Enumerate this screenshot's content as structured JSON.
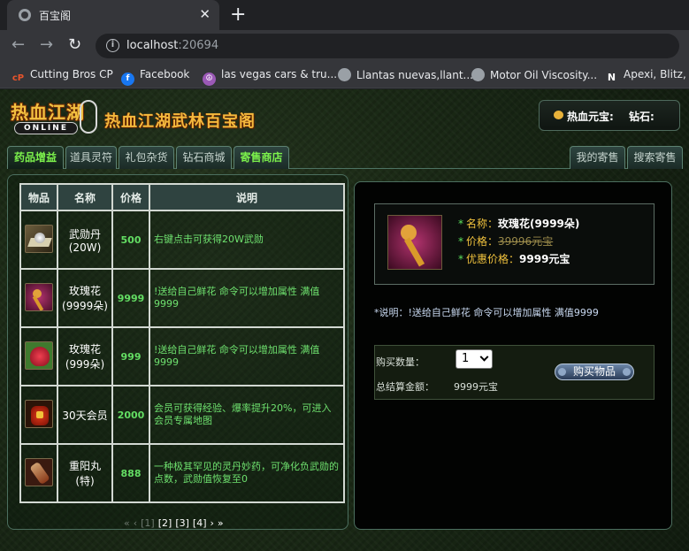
{
  "browser": {
    "tab_title": "百宝阁",
    "tab_close": "✕",
    "new_tab": "+",
    "url_host": "localhost",
    "url_port": ":20694",
    "bookmarks": [
      {
        "label": "Cutting Bros CP",
        "icon": "cp-icon",
        "color": "#e8542b"
      },
      {
        "label": "Facebook",
        "icon": "facebook-icon",
        "color": "#1877f2"
      },
      {
        "label": "las vegas cars & tru...",
        "icon": "peace-icon",
        "color": "#9b59b6"
      },
      {
        "label": "Llantas nuevas,llant...",
        "icon": "globe-icon",
        "color": "#9aa0a6"
      },
      {
        "label": "Motor Oil Viscosity...",
        "icon": "globe-icon",
        "color": "#9aa0a6"
      },
      {
        "label": "Apexi, Blitz, H",
        "icon": "n-icon",
        "color": "#ffffff"
      }
    ]
  },
  "header": {
    "logo_text": "热血江湖",
    "logo_sub": "ONLINE",
    "title": "热血江湖武林百宝阁",
    "balance_yuanbao_label": "热血元宝:",
    "balance_diamond_label": "钻石:"
  },
  "tabs": [
    {
      "label": "药品增益",
      "state": "active"
    },
    {
      "label": "道具灵符",
      "state": "normal"
    },
    {
      "label": "礼包杂货",
      "state": "normal"
    },
    {
      "label": "钻石商城",
      "state": "normal"
    },
    {
      "label": "寄售商店",
      "state": "highlight"
    }
  ],
  "right_tabs": [
    {
      "label": "我的寄售"
    },
    {
      "label": "搜索寄售"
    }
  ],
  "table": {
    "headers": [
      "物品",
      "名称",
      "价格",
      "说明"
    ],
    "rows": [
      {
        "icon": "pearl-plate-icon",
        "name": "武勋丹\n(20W)",
        "price": "500",
        "desc": "右键点击可获得20W武勋"
      },
      {
        "icon": "rose-staff-icon",
        "name": "玫瑰花\n(9999朵)",
        "price": "9999",
        "desc": "!送给自己鲜花 命令可以增加属性 满值9999"
      },
      {
        "icon": "heart-rose-icon",
        "name": "玫瑰花\n(999朵)",
        "price": "999",
        "desc": "!送给自己鲜花 命令可以增加属性 满值9999"
      },
      {
        "icon": "red-bag-icon",
        "name": "30天会员",
        "price": "2000",
        "desc": "会员可获得经验、爆率提升20%，可进入会员专属地图"
      },
      {
        "icon": "pill-bottle-icon",
        "name": "重阳丸\n(特)",
        "price": "888",
        "desc": "一种极其罕见的灵丹妙药，可净化负武勋的点数，武勋值恢复至0"
      }
    ]
  },
  "pager": {
    "first": "«",
    "prev": "‹",
    "current": "[1]",
    "pages": [
      "[2]",
      "[3]",
      "[4]"
    ],
    "next": "›",
    "last": "»"
  },
  "detail": {
    "name_label": "名称：",
    "name_value": "玫瑰花(9999朵)",
    "price_label": "价格：",
    "price_value": "39996元宝",
    "discount_label": "优惠价格：",
    "discount_value": "9999元宝",
    "note_label": "说明：",
    "note_value": "!送给自己鲜花 命令可以增加属性 满值9999"
  },
  "purchase": {
    "qty_label": "购买数量：",
    "qty_value": "1",
    "total_label": "总结算金额：",
    "total_value": "9999元宝",
    "buy_label": "购买物品"
  }
}
